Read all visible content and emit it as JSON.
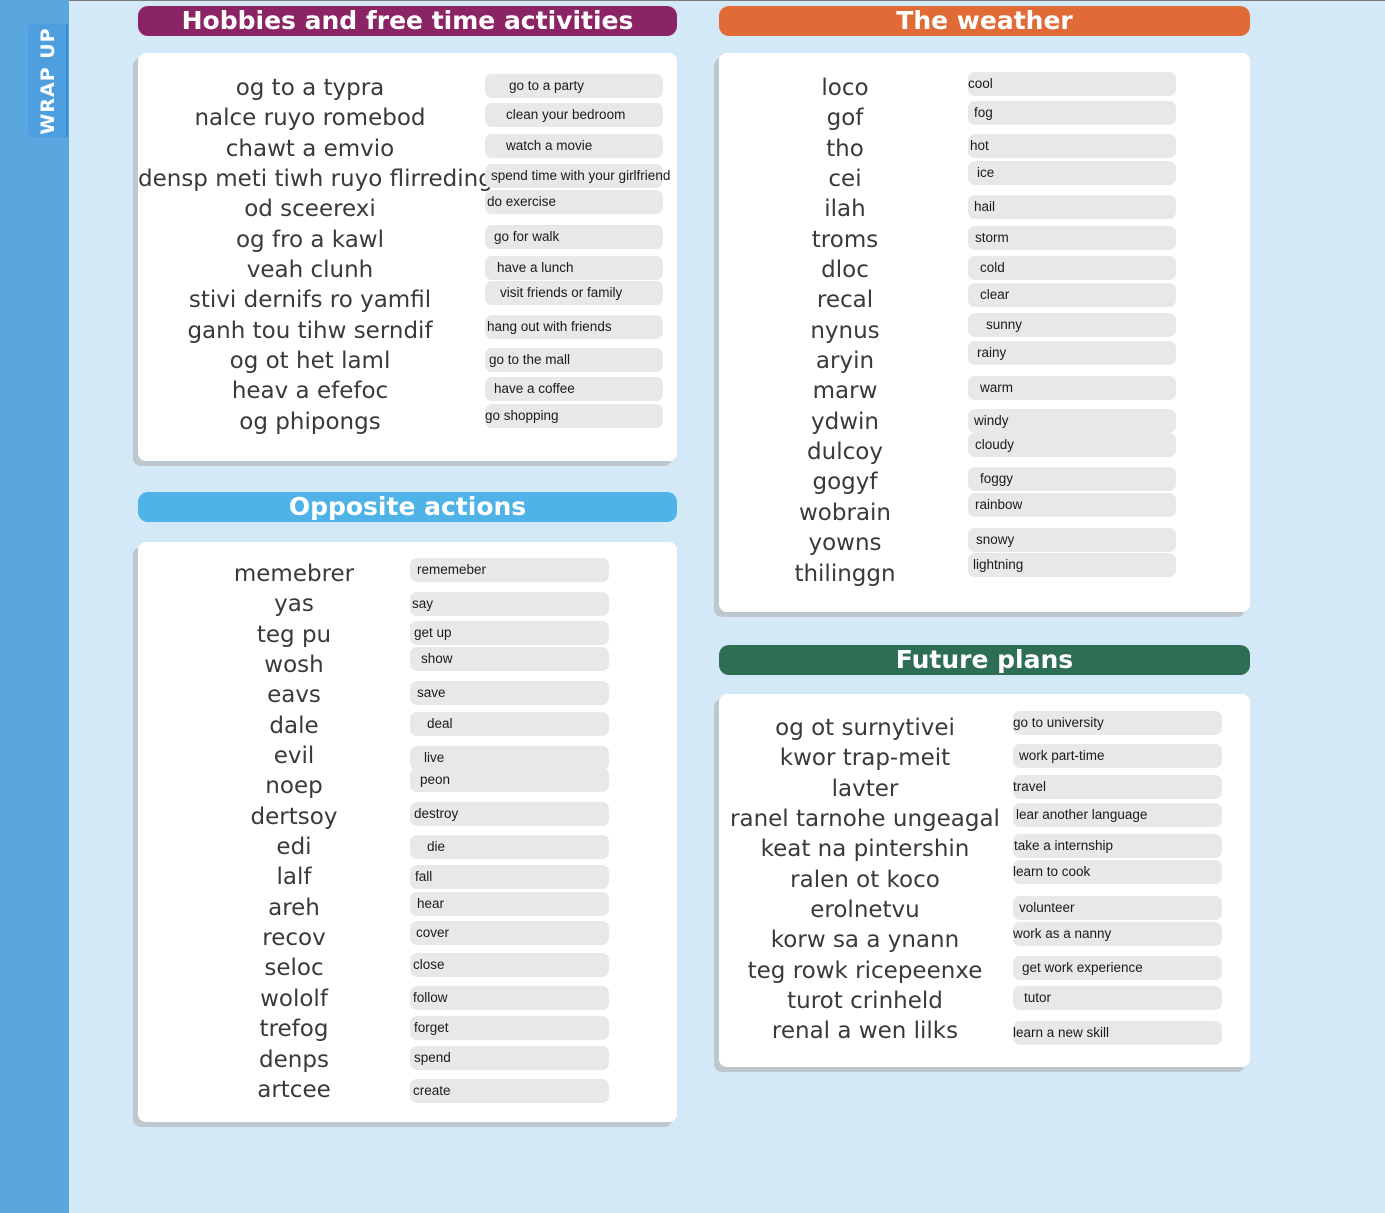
{
  "sidebar": {
    "tab_label": "WRAP UP"
  },
  "colors": {
    "hobbies": "#8b2464",
    "weather": "#e06b36",
    "opposite": "#4fb3e8",
    "future": "#2e6e55",
    "background": "#d3e9f7",
    "sidebar": "#5aa7e0"
  },
  "hobbies": {
    "title": "Hobbies and free time activities",
    "scrambled": [
      "og to a typra",
      "nalce ruyo romebod",
      "chawt a emvio",
      "densp meti tiwh ruyo flirreding",
      "od sceerexi",
      "og fro a kawl",
      "veah clunh",
      "stivi dernifs ro yamfil",
      "ganh tou tihw serndif",
      "og ot het laml",
      "heav a efefoc",
      "og phipongs"
    ],
    "answers": [
      "go to a party",
      "clean your bedroom",
      "watch a movie",
      "spend time with your girlfriend",
      "do exercise",
      "go for walk",
      "have a lunch",
      "visit friends or family",
      "hang out with friends",
      "go to the mall",
      "have a coffee",
      "go   shopping"
    ]
  },
  "weather": {
    "title": "The weather",
    "scrambled": [
      "loco",
      "gof",
      "tho",
      "cei",
      "ilah",
      "troms",
      "dloc",
      "recal",
      "nynus",
      "aryin",
      "marw",
      "ydwin",
      "dulcoy",
      "gogyf",
      "wobrain",
      "yowns",
      "thilinggn"
    ],
    "answers": [
      "cool",
      "fog",
      "hot",
      "ice",
      "hail",
      "storm",
      "cold",
      "clear",
      "sunny",
      "rainy",
      "warm",
      "windy",
      "cloudy",
      "foggy",
      "rainbow",
      "snowy",
      "lightning"
    ]
  },
  "opposite": {
    "title": "Opposite actions",
    "scrambled": [
      "memebrer",
      "yas",
      "teg pu",
      "wosh",
      "eavs",
      "dale",
      "evil",
      "noep",
      "dertsoy",
      "edi",
      "lalf",
      "areh",
      "recov",
      "seloc",
      "wololf",
      "trefog",
      "denps",
      "artcee"
    ],
    "answers": [
      "rememeber",
      "say",
      "get up",
      "show",
      "save",
      "deal",
      "live",
      "peon",
      "destroy",
      "die",
      "fall",
      "hear",
      "cover",
      "close",
      "follow",
      "forget",
      "spend",
      "create"
    ]
  },
  "future": {
    "title": "Future plans",
    "scrambled": [
      "og ot surnytivei",
      "kwor trap-meit",
      "lavter",
      "ranel tarnohe ungeagal",
      "keat na pintershin",
      "ralen ot koco",
      "erolnetvu",
      "korw sa a ynann",
      "teg rowk ricepeenxe",
      "turot crinheld",
      "renal a wen lilks"
    ],
    "answers": [
      "go to university",
      "work part-time",
      "travel",
      "lear another language",
      "take a internship",
      "learn to cook",
      "volunteer",
      "work as a nanny",
      "get work experience",
      "tutor",
      "learn a new skill"
    ]
  }
}
